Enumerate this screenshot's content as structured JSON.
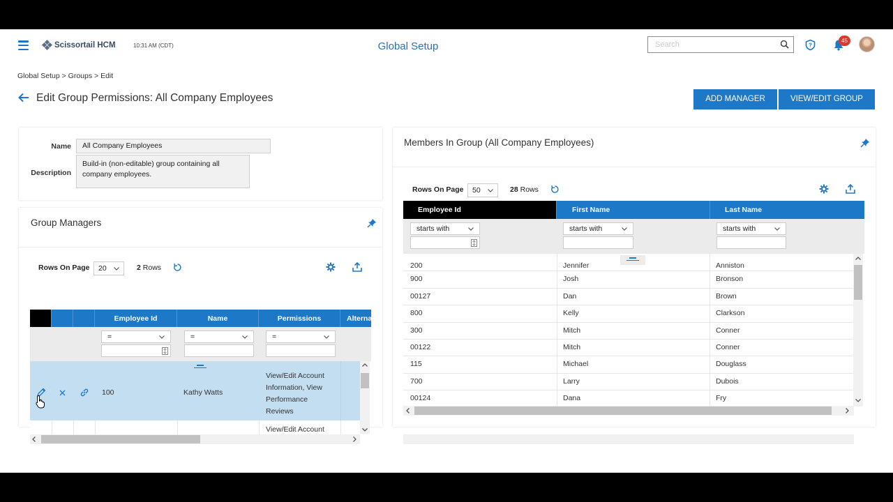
{
  "header": {
    "brand": "Scissortail HCM",
    "time": "10:31 AM (CDT)",
    "title": "Global Setup",
    "search_placeholder": "Search",
    "notifications": "45"
  },
  "breadcrumb": "Global Setup > Groups > Edit",
  "page_title": "Edit Group Permissions: All Company Employees",
  "buttons": {
    "add_manager": "ADD MANAGER",
    "view_edit_group": "VIEW/EDIT GROUP"
  },
  "info": {
    "name_label": "Name",
    "name_value": "All Company Employees",
    "desc_label": "Description",
    "desc_line1": "Build-in (non-editable) group containing all",
    "desc_line2": "company employees."
  },
  "managers": {
    "title": "Group Managers",
    "rows_label": "Rows On Page",
    "rows_value": "20",
    "row_count": "2",
    "rows_word": "Rows",
    "columns": [
      "Employee Id",
      "Name",
      "Permissions",
      "Alterna"
    ],
    "filter_op": "=",
    "rows": [
      {
        "id": "100",
        "name": "Kathy Watts",
        "perm": [
          "View/Edit Account",
          "Information, View",
          "Performance",
          "Reviews"
        ]
      },
      {
        "id": "",
        "name": "",
        "perm": [
          "View/Edit Account"
        ]
      }
    ]
  },
  "members": {
    "title": "Members In Group (All Company Employees)",
    "rows_label": "Rows On Page",
    "rows_value": "50",
    "row_count": "28",
    "rows_word": "Rows",
    "columns": [
      "Employee Id",
      "First Name",
      "Last Name"
    ],
    "filter_op": "starts with",
    "rows": [
      {
        "id": "200",
        "first": "Jennifer",
        "last": "Anniston"
      },
      {
        "id": "900",
        "first": "Josh",
        "last": "Bronson"
      },
      {
        "id": "00127",
        "first": "Dan",
        "last": "Brown"
      },
      {
        "id": "800",
        "first": "Kelly",
        "last": "Clarkson"
      },
      {
        "id": "300",
        "first": "Mitch",
        "last": "Conner"
      },
      {
        "id": "00122",
        "first": "Mitch",
        "last": "Conner"
      },
      {
        "id": "115",
        "first": "Michael",
        "last": "Douglass"
      },
      {
        "id": "700",
        "first": "Larry",
        "last": "Dubois"
      },
      {
        "id": "00124",
        "first": "Dana",
        "last": "Fry"
      }
    ]
  },
  "colors": {
    "accent": "#1e78c8",
    "selected_row": "#c3ddf1",
    "badge": "#d63b2f"
  }
}
